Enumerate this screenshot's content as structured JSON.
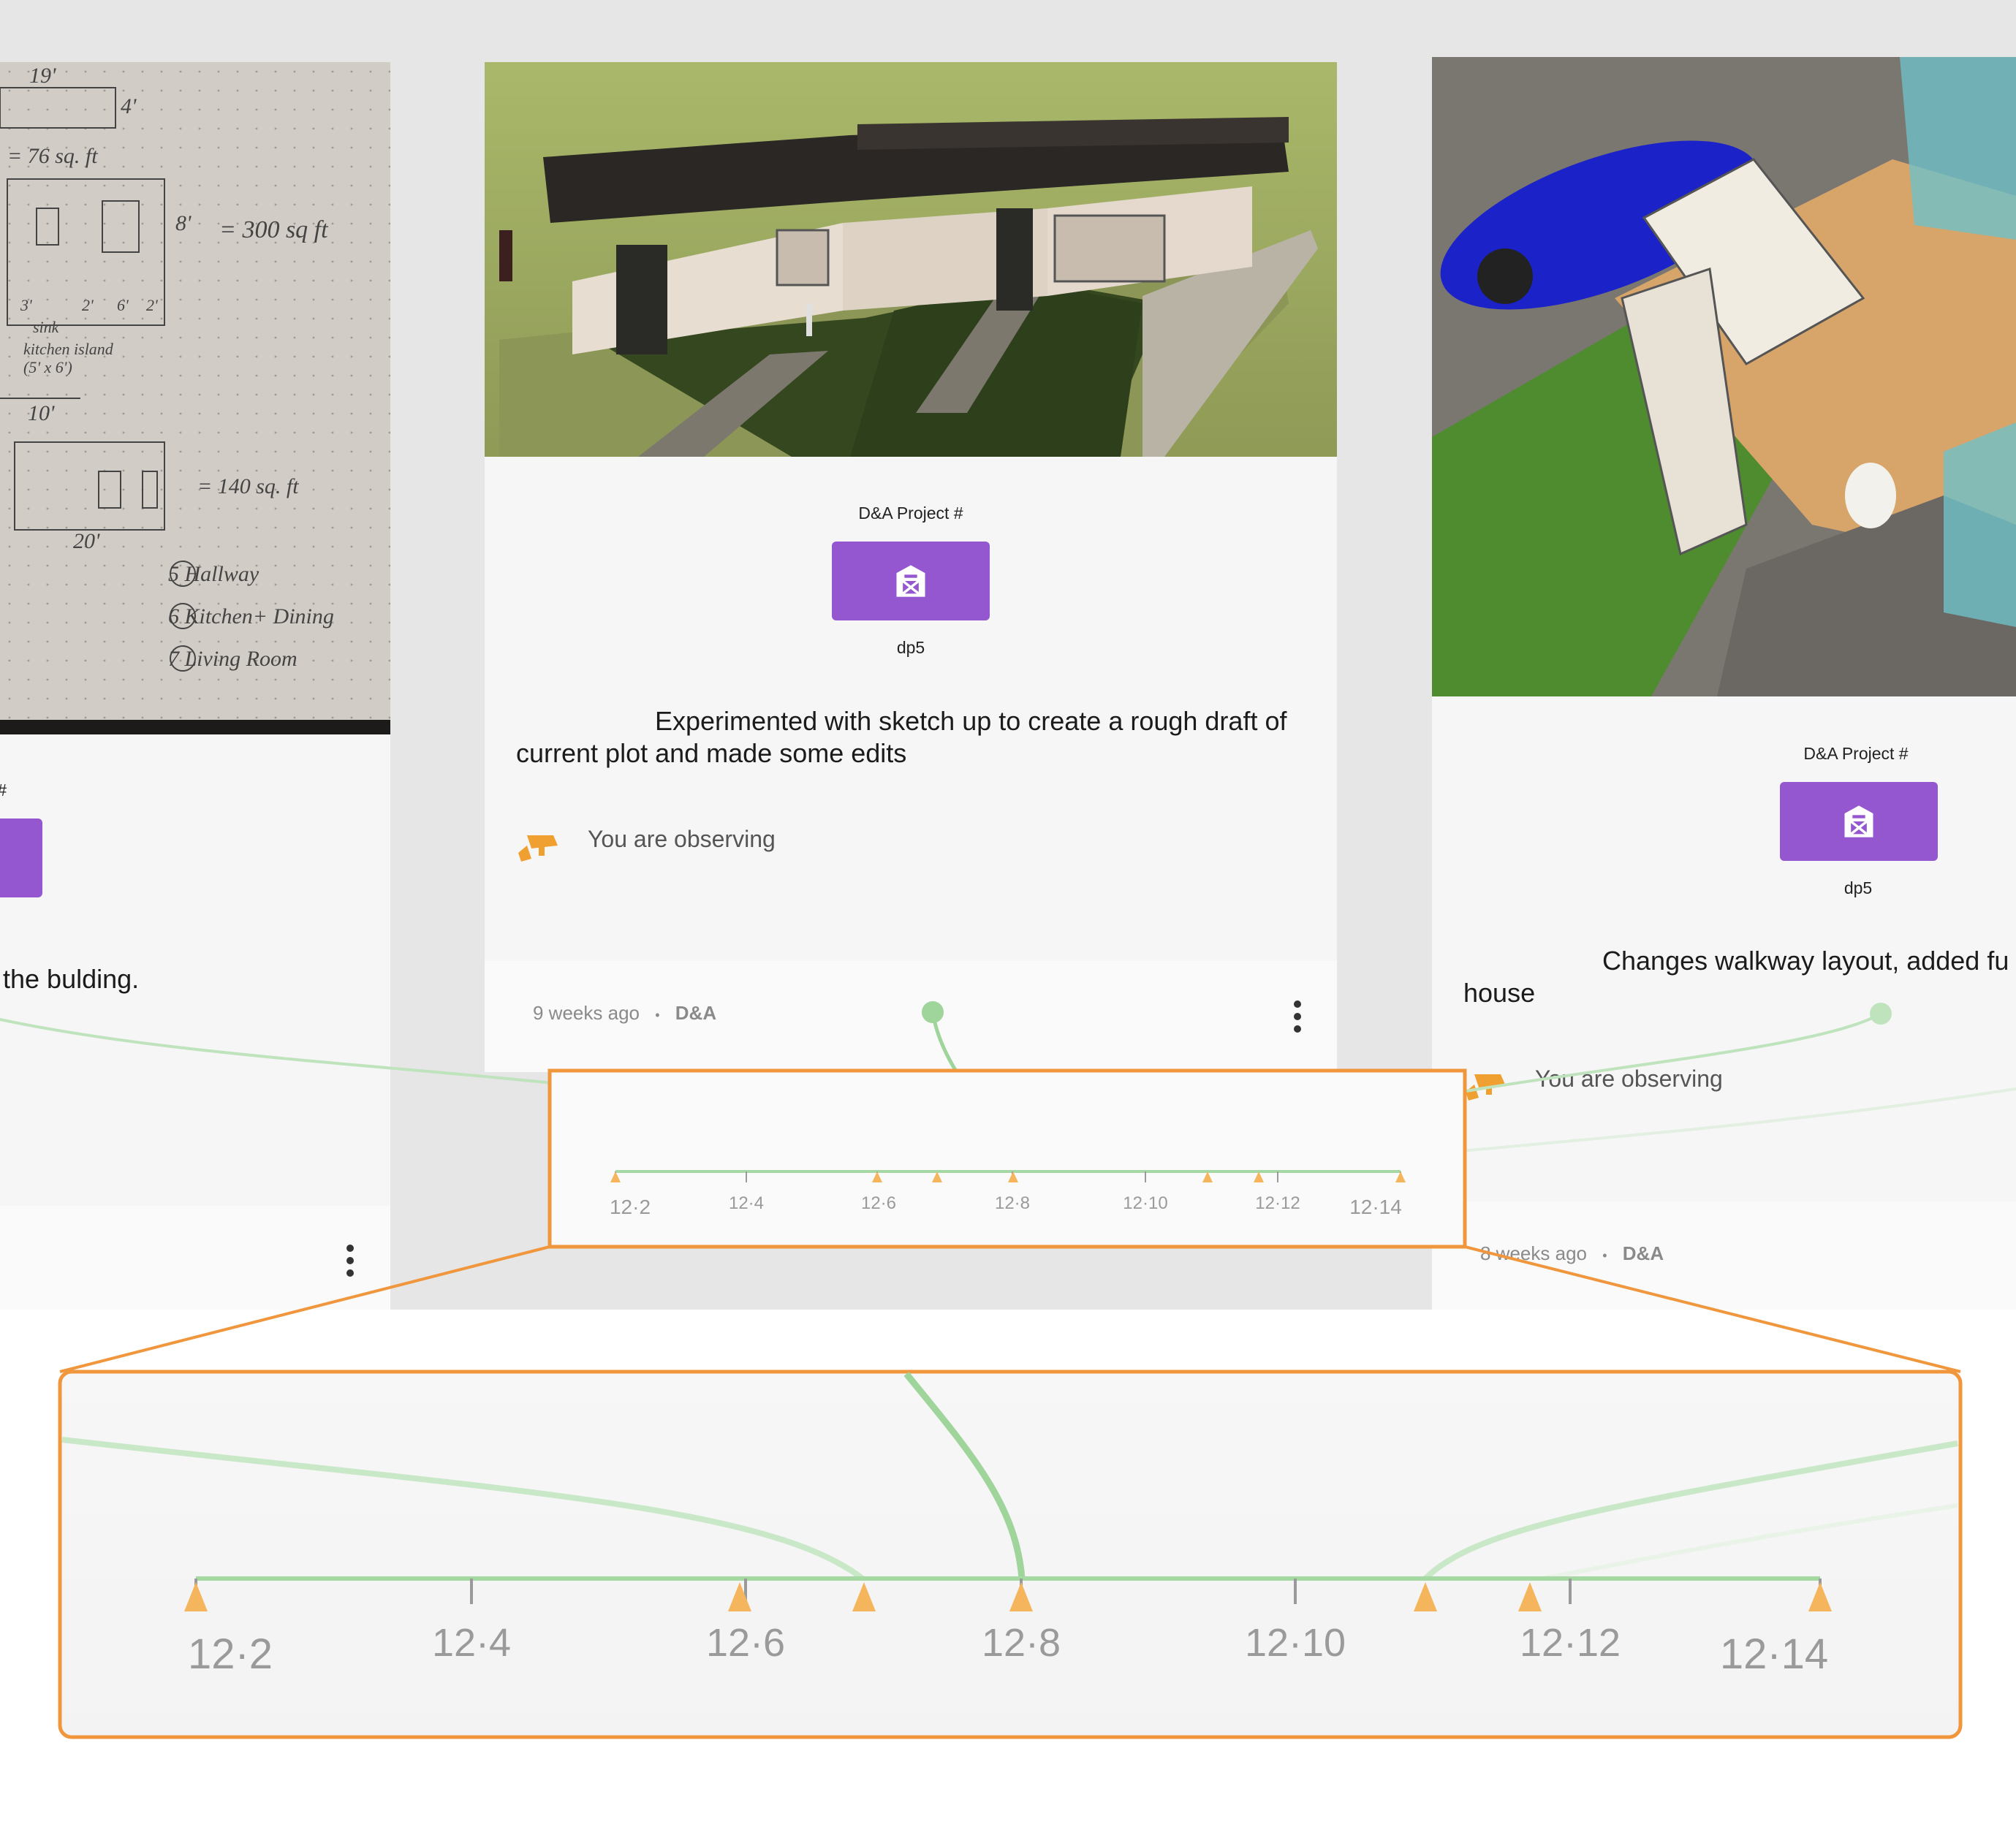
{
  "cards": {
    "left": {
      "project_label_fragment": "t #",
      "description_fragment": "the bulding.",
      "sketch_notes": [
        "19'",
        "4'",
        "= 76 sq. ft",
        "8'",
        "= 300 sq ft",
        "3'",
        "sink",
        "2'",
        "6'",
        "2'",
        "kitchen island",
        "(5' x 6')",
        "10'",
        "= 140 sq. ft",
        "20'",
        "5 Hallway",
        "6 Kitchen+ Dining",
        "7 Living Room"
      ]
    },
    "center": {
      "project_label": "D&A Project #",
      "project_code": "dp5",
      "description": "Experimented with sketch up to create a rough draft of current plot and made some edits",
      "observing": "You are observing",
      "time_ago": "9 weeks ago",
      "separator": "•",
      "owner": "D&A"
    },
    "right": {
      "project_label": "D&A Project #",
      "project_code": "dp5",
      "description": "Changes walkway layout, added fu house",
      "observing": "You are observing",
      "time_ago": "8 weeks ago",
      "separator": "•",
      "owner": "D&A"
    }
  },
  "timeline": {
    "tick_labels": [
      "12·2",
      "12·4",
      "12·6",
      "12·8",
      "12·10",
      "12·12",
      "12·14"
    ],
    "colors": {
      "line": "#a6d8a4",
      "marker": "#f5b55c",
      "node": "#9fd49b",
      "highlight": "#f0963d"
    }
  },
  "icons": {
    "project": "barn-icon",
    "observe": "security-camera-icon",
    "menu": "vertical-dots-icon"
  }
}
